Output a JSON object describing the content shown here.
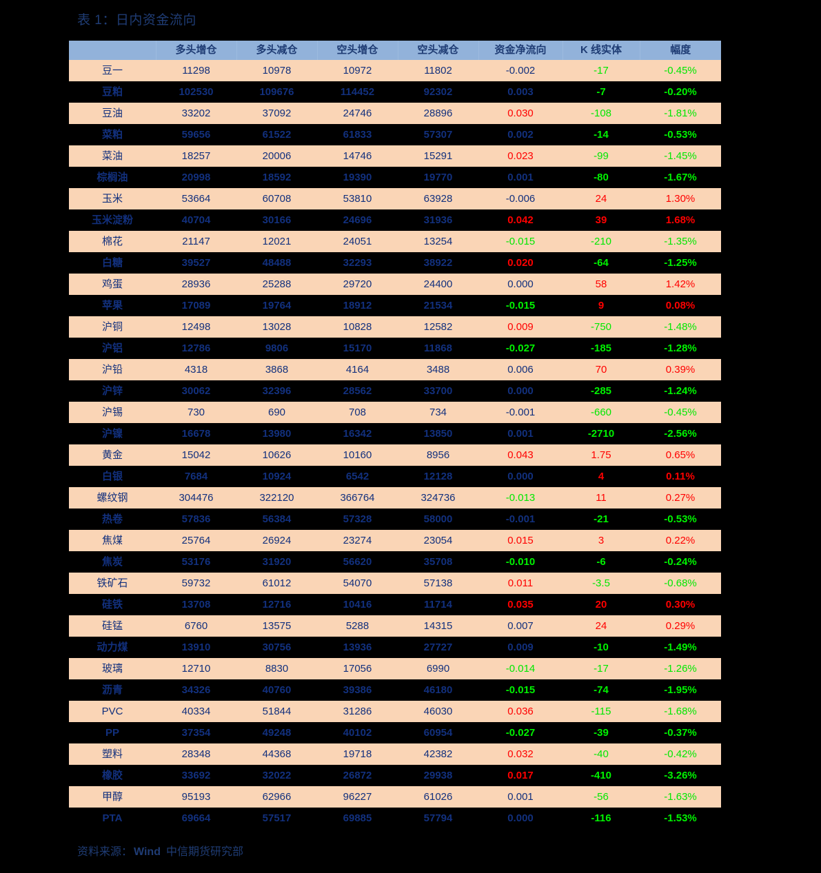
{
  "title": "表 1：日内资金流向",
  "colors": {
    "header_bg": "#92b2da",
    "row_light_bg": "#fad5b6",
    "row_dark_bg": "#000000",
    "text_blue": "#12307d",
    "up_red": "#ff0000",
    "down_green": "#00e800"
  },
  "table": {
    "headers": [
      "",
      "多头增仓",
      "多头减仓",
      "空头增仓",
      "空头减仓",
      "资金净流向",
      "K 线实体",
      "幅度"
    ],
    "rows": [
      {
        "name": "豆一",
        "long_add": "11298",
        "long_cut": "10978",
        "short_add": "10972",
        "short_cut": "11802",
        "net": "-0.002",
        "net_dir": "flat",
        "body": "-17",
        "body_dir": "down",
        "amp": "-0.45%",
        "amp_dir": "down"
      },
      {
        "name": "豆粕",
        "long_add": "102530",
        "long_cut": "109676",
        "short_add": "114452",
        "short_cut": "92302",
        "net": "0.003",
        "net_dir": "flat",
        "body": "-7",
        "body_dir": "down",
        "amp": "-0.20%",
        "amp_dir": "down"
      },
      {
        "name": "豆油",
        "long_add": "33202",
        "long_cut": "37092",
        "short_add": "24746",
        "short_cut": "28896",
        "net": "0.030",
        "net_dir": "up",
        "body": "-108",
        "body_dir": "down",
        "amp": "-1.81%",
        "amp_dir": "down"
      },
      {
        "name": "菜粕",
        "long_add": "59656",
        "long_cut": "61522",
        "short_add": "61833",
        "short_cut": "57307",
        "net": "0.002",
        "net_dir": "flat",
        "body": "-14",
        "body_dir": "down",
        "amp": "-0.53%",
        "amp_dir": "down"
      },
      {
        "name": "菜油",
        "long_add": "18257",
        "long_cut": "20006",
        "short_add": "14746",
        "short_cut": "15291",
        "net": "0.023",
        "net_dir": "up",
        "body": "-99",
        "body_dir": "down",
        "amp": "-1.45%",
        "amp_dir": "down"
      },
      {
        "name": "棕榈油",
        "long_add": "20998",
        "long_cut": "18592",
        "short_add": "19390",
        "short_cut": "19770",
        "net": "0.001",
        "net_dir": "flat",
        "body": "-80",
        "body_dir": "down",
        "amp": "-1.67%",
        "amp_dir": "down"
      },
      {
        "name": "玉米",
        "long_add": "53664",
        "long_cut": "60708",
        "short_add": "53810",
        "short_cut": "63928",
        "net": "-0.006",
        "net_dir": "flat",
        "body": "24",
        "body_dir": "up",
        "amp": "1.30%",
        "amp_dir": "up"
      },
      {
        "name": "玉米淀粉",
        "long_add": "40704",
        "long_cut": "30166",
        "short_add": "24696",
        "short_cut": "31936",
        "net": "0.042",
        "net_dir": "up",
        "body": "39",
        "body_dir": "up",
        "amp": "1.68%",
        "amp_dir": "up"
      },
      {
        "name": "棉花",
        "long_add": "21147",
        "long_cut": "12021",
        "short_add": "24051",
        "short_cut": "13254",
        "net": "-0.015",
        "net_dir": "down",
        "body": "-210",
        "body_dir": "down",
        "amp": "-1.35%",
        "amp_dir": "down"
      },
      {
        "name": "白糖",
        "long_add": "39527",
        "long_cut": "48488",
        "short_add": "32293",
        "short_cut": "38922",
        "net": "0.020",
        "net_dir": "up",
        "body": "-64",
        "body_dir": "down",
        "amp": "-1.25%",
        "amp_dir": "down"
      },
      {
        "name": "鸡蛋",
        "long_add": "28936",
        "long_cut": "25288",
        "short_add": "29720",
        "short_cut": "24400",
        "net": "0.000",
        "net_dir": "flat",
        "body": "58",
        "body_dir": "up",
        "amp": "1.42%",
        "amp_dir": "up"
      },
      {
        "name": "苹果",
        "long_add": "17089",
        "long_cut": "19764",
        "short_add": "18912",
        "short_cut": "21534",
        "net": "-0.015",
        "net_dir": "down",
        "body": "9",
        "body_dir": "up",
        "amp": "0.08%",
        "amp_dir": "up"
      },
      {
        "name": "沪铜",
        "long_add": "12498",
        "long_cut": "13028",
        "short_add": "10828",
        "short_cut": "12582",
        "net": "0.009",
        "net_dir": "up",
        "body": "-750",
        "body_dir": "down",
        "amp": "-1.48%",
        "amp_dir": "down"
      },
      {
        "name": "沪铝",
        "long_add": "12786",
        "long_cut": "9806",
        "short_add": "15170",
        "short_cut": "11868",
        "net": "-0.027",
        "net_dir": "down",
        "body": "-185",
        "body_dir": "down",
        "amp": "-1.28%",
        "amp_dir": "down"
      },
      {
        "name": "沪铅",
        "long_add": "4318",
        "long_cut": "3868",
        "short_add": "4164",
        "short_cut": "3488",
        "net": "0.006",
        "net_dir": "flat",
        "body": "70",
        "body_dir": "up",
        "amp": "0.39%",
        "amp_dir": "up"
      },
      {
        "name": "沪锌",
        "long_add": "30062",
        "long_cut": "32396",
        "short_add": "28562",
        "short_cut": "33700",
        "net": "0.000",
        "net_dir": "flat",
        "body": "-285",
        "body_dir": "down",
        "amp": "-1.24%",
        "amp_dir": "down"
      },
      {
        "name": "沪锡",
        "long_add": "730",
        "long_cut": "690",
        "short_add": "708",
        "short_cut": "734",
        "net": "-0.001",
        "net_dir": "flat",
        "body": "-660",
        "body_dir": "down",
        "amp": "-0.45%",
        "amp_dir": "down"
      },
      {
        "name": "沪镍",
        "long_add": "16678",
        "long_cut": "13980",
        "short_add": "16342",
        "short_cut": "13850",
        "net": "0.001",
        "net_dir": "flat",
        "body": "-2710",
        "body_dir": "down",
        "amp": "-2.56%",
        "amp_dir": "down"
      },
      {
        "name": "黄金",
        "long_add": "15042",
        "long_cut": "10626",
        "short_add": "10160",
        "short_cut": "8956",
        "net": "0.043",
        "net_dir": "up",
        "body": "1.75",
        "body_dir": "up",
        "amp": "0.65%",
        "amp_dir": "up"
      },
      {
        "name": "白银",
        "long_add": "7684",
        "long_cut": "10924",
        "short_add": "6542",
        "short_cut": "12128",
        "net": "0.000",
        "net_dir": "flat",
        "body": "4",
        "body_dir": "up",
        "amp": "0.11%",
        "amp_dir": "up"
      },
      {
        "name": "螺纹钢",
        "long_add": "304476",
        "long_cut": "322120",
        "short_add": "366764",
        "short_cut": "324736",
        "net": "-0.013",
        "net_dir": "down",
        "body": "11",
        "body_dir": "up",
        "amp": "0.27%",
        "amp_dir": "up"
      },
      {
        "name": "热卷",
        "long_add": "57836",
        "long_cut": "56384",
        "short_add": "57328",
        "short_cut": "58000",
        "net": "-0.001",
        "net_dir": "flat",
        "body": "-21",
        "body_dir": "down",
        "amp": "-0.53%",
        "amp_dir": "down"
      },
      {
        "name": "焦煤",
        "long_add": "25764",
        "long_cut": "26924",
        "short_add": "23274",
        "short_cut": "23054",
        "net": "0.015",
        "net_dir": "up",
        "body": "3",
        "body_dir": "up",
        "amp": "0.22%",
        "amp_dir": "up"
      },
      {
        "name": "焦炭",
        "long_add": "53176",
        "long_cut": "31920",
        "short_add": "56620",
        "short_cut": "35708",
        "net": "-0.010",
        "net_dir": "down",
        "body": "-6",
        "body_dir": "down",
        "amp": "-0.24%",
        "amp_dir": "down"
      },
      {
        "name": "铁矿石",
        "long_add": "59732",
        "long_cut": "61012",
        "short_add": "54070",
        "short_cut": "57138",
        "net": "0.011",
        "net_dir": "up",
        "body": "-3.5",
        "body_dir": "down",
        "amp": "-0.68%",
        "amp_dir": "down"
      },
      {
        "name": "硅铁",
        "long_add": "13708",
        "long_cut": "12716",
        "short_add": "10416",
        "short_cut": "11714",
        "net": "0.035",
        "net_dir": "up",
        "body": "20",
        "body_dir": "up",
        "amp": "0.30%",
        "amp_dir": "up"
      },
      {
        "name": "硅锰",
        "long_add": "6760",
        "long_cut": "13575",
        "short_add": "5288",
        "short_cut": "14315",
        "net": "0.007",
        "net_dir": "flat",
        "body": "24",
        "body_dir": "up",
        "amp": "0.29%",
        "amp_dir": "up"
      },
      {
        "name": "动力煤",
        "long_add": "13910",
        "long_cut": "30756",
        "short_add": "13936",
        "short_cut": "27727",
        "net": "0.009",
        "net_dir": "flat",
        "body": "-10",
        "body_dir": "down",
        "amp": "-1.49%",
        "amp_dir": "down"
      },
      {
        "name": "玻璃",
        "long_add": "12710",
        "long_cut": "8830",
        "short_add": "17056",
        "short_cut": "6990",
        "net": "-0.014",
        "net_dir": "down",
        "body": "-17",
        "body_dir": "down",
        "amp": "-1.26%",
        "amp_dir": "down"
      },
      {
        "name": "沥青",
        "long_add": "34326",
        "long_cut": "40760",
        "short_add": "39386",
        "short_cut": "46180",
        "net": "-0.015",
        "net_dir": "down",
        "body": "-74",
        "body_dir": "down",
        "amp": "-1.95%",
        "amp_dir": "down"
      },
      {
        "name": "PVC",
        "long_add": "40334",
        "long_cut": "51844",
        "short_add": "31286",
        "short_cut": "46030",
        "net": "0.036",
        "net_dir": "up",
        "body": "-115",
        "body_dir": "down",
        "amp": "-1.68%",
        "amp_dir": "down"
      },
      {
        "name": "PP",
        "long_add": "37354",
        "long_cut": "49248",
        "short_add": "40102",
        "short_cut": "60954",
        "net": "-0.027",
        "net_dir": "down",
        "body": "-39",
        "body_dir": "down",
        "amp": "-0.37%",
        "amp_dir": "down"
      },
      {
        "name": "塑料",
        "long_add": "28348",
        "long_cut": "44368",
        "short_add": "19718",
        "short_cut": "42382",
        "net": "0.032",
        "net_dir": "up",
        "body": "-40",
        "body_dir": "down",
        "amp": "-0.42%",
        "amp_dir": "down"
      },
      {
        "name": "橡胶",
        "long_add": "33692",
        "long_cut": "32022",
        "short_add": "26872",
        "short_cut": "29938",
        "net": "0.017",
        "net_dir": "up",
        "body": "-410",
        "body_dir": "down",
        "amp": "-3.26%",
        "amp_dir": "down"
      },
      {
        "name": "甲醇",
        "long_add": "95193",
        "long_cut": "62966",
        "short_add": "96227",
        "short_cut": "61026",
        "net": "0.001",
        "net_dir": "flat",
        "body": "-56",
        "body_dir": "down",
        "amp": "-1.63%",
        "amp_dir": "down"
      },
      {
        "name": "PTA",
        "long_add": "69664",
        "long_cut": "57517",
        "short_add": "69885",
        "short_cut": "57794",
        "net": "0.000",
        "net_dir": "flat",
        "body": "-116",
        "body_dir": "down",
        "amp": "-1.53%",
        "amp_dir": "down"
      }
    ]
  },
  "source": {
    "label": "资料来源：",
    "provider": "Wind",
    "department": "中信期货研究部"
  }
}
